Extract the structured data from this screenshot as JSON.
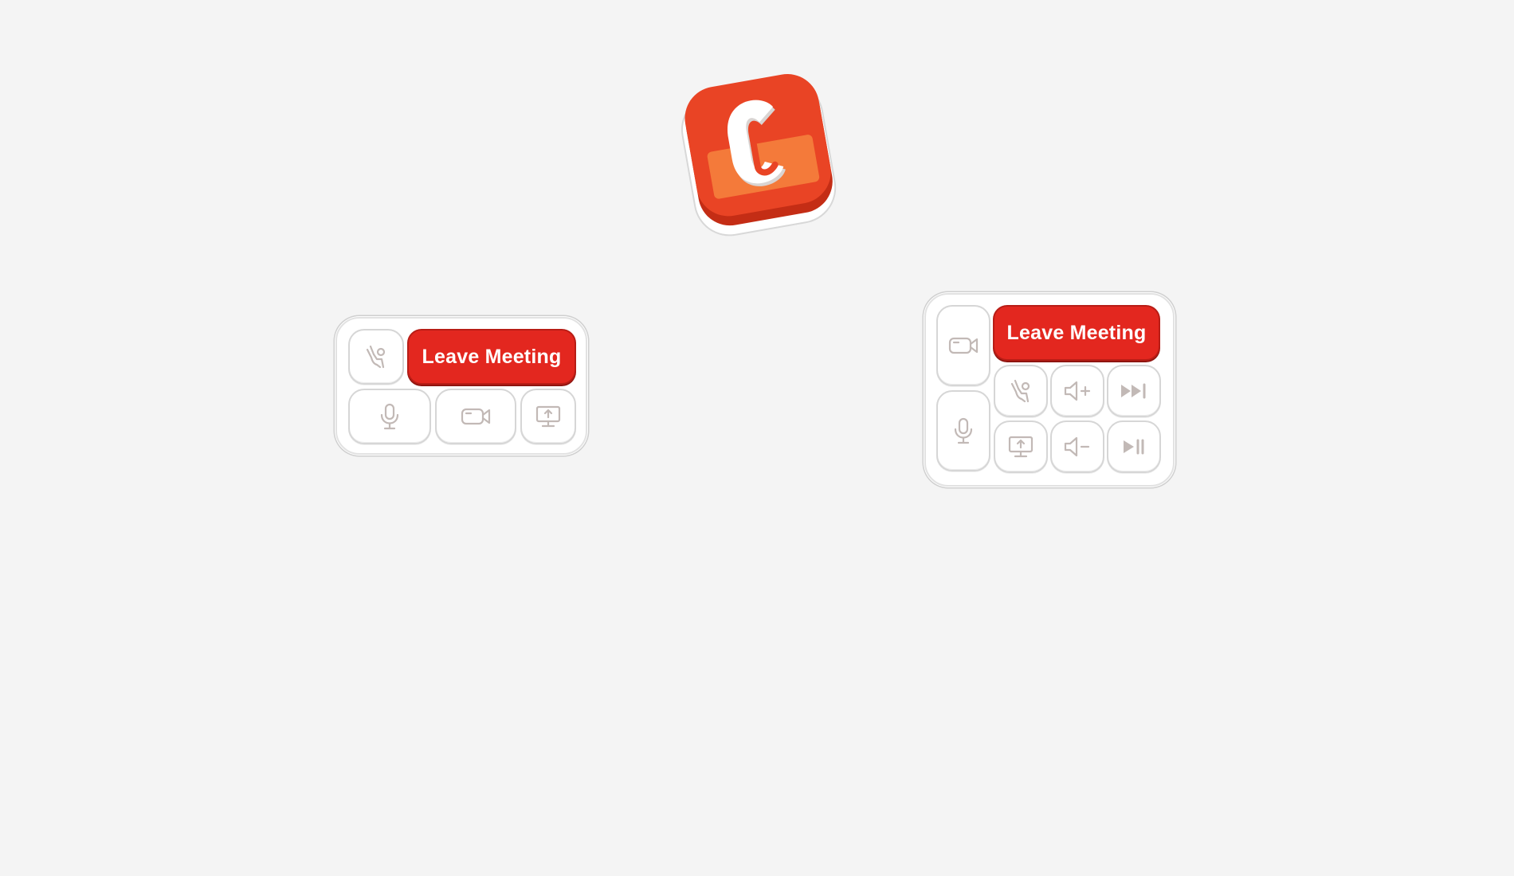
{
  "logo": {
    "letter": "C",
    "brand_color": "#e94425",
    "accent_color": "#f47a3a"
  },
  "panels": {
    "compact": {
      "leave_label": "Leave Meeting",
      "buttons": [
        {
          "name": "raise-hand",
          "icon": "raise-hand-icon"
        },
        {
          "name": "microphone",
          "icon": "microphone-icon"
        },
        {
          "name": "camera",
          "icon": "video-camera-icon"
        },
        {
          "name": "share-screen",
          "icon": "screen-share-icon"
        }
      ]
    },
    "extended": {
      "leave_label": "Leave Meeting",
      "buttons": [
        {
          "name": "camera",
          "icon": "video-camera-icon"
        },
        {
          "name": "microphone",
          "icon": "microphone-icon"
        },
        {
          "name": "raise-hand",
          "icon": "raise-hand-icon"
        },
        {
          "name": "volume-up",
          "icon": "volume-up-icon"
        },
        {
          "name": "next-track",
          "icon": "next-track-icon"
        },
        {
          "name": "share-screen",
          "icon": "screen-share-icon"
        },
        {
          "name": "volume-down",
          "icon": "volume-down-icon"
        },
        {
          "name": "play-pause",
          "icon": "play-pause-icon"
        }
      ]
    }
  },
  "colors": {
    "background": "#f4f4f4",
    "leave_red": "#e3271f",
    "icon_gray": "#c2b9b6"
  }
}
